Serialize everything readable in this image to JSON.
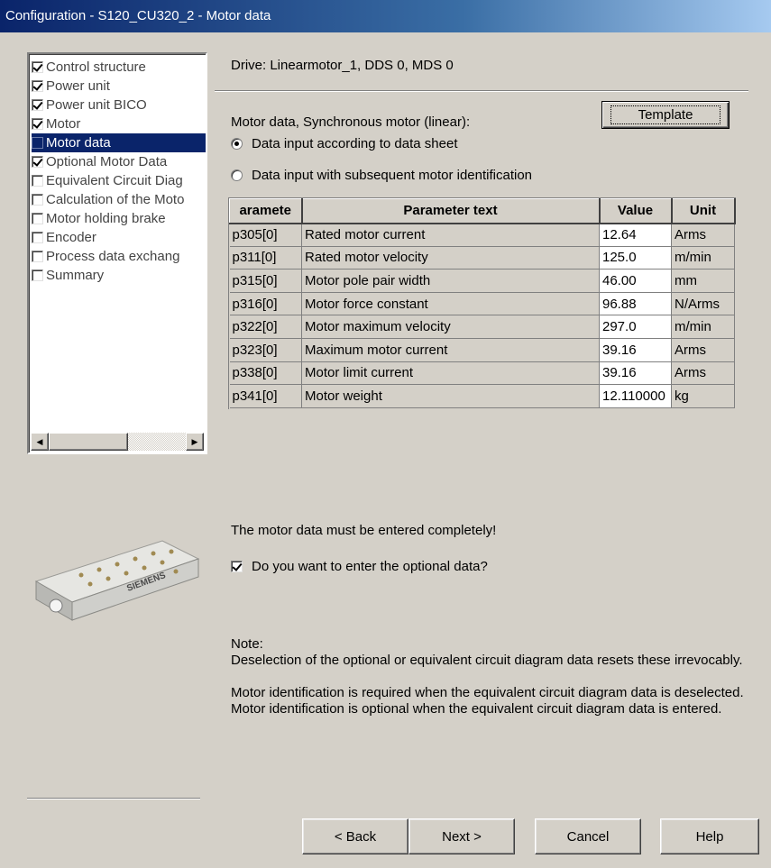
{
  "window": {
    "title": "Configuration - S120_CU320_2 - Motor data"
  },
  "tree": {
    "items": [
      {
        "label": "Control structure",
        "checked": true
      },
      {
        "label": "Power unit",
        "checked": true
      },
      {
        "label": "Power unit BICO",
        "checked": true
      },
      {
        "label": "Motor",
        "checked": true
      },
      {
        "label": "Motor data",
        "checked": false,
        "selected": true
      },
      {
        "label": "Optional Motor Data",
        "checked": true
      },
      {
        "label": "Equivalent Circuit Diag",
        "checked": false
      },
      {
        "label": "Calculation of the Moto",
        "checked": false
      },
      {
        "label": "Motor holding brake",
        "checked": false
      },
      {
        "label": "Encoder",
        "checked": false
      },
      {
        "label": "Process data exchang",
        "checked": false
      },
      {
        "label": "Summary",
        "checked": false
      }
    ]
  },
  "main": {
    "drive_label": "Drive: Linearmotor_1, DDS 0, MDS 0",
    "section_label": "Motor data, Synchronous motor (linear):",
    "template_button": "Template",
    "radio_datasheet": "Data input according to data sheet",
    "radio_identification": "Data input with subsequent motor identification",
    "table": {
      "headers": [
        "aramete",
        "Parameter text",
        "Value",
        "Unit"
      ],
      "rows": [
        [
          "p305[0]",
          "Rated motor current",
          "12.64",
          "Arms"
        ],
        [
          "p311[0]",
          "Rated motor velocity",
          "125.0",
          "m/min"
        ],
        [
          "p315[0]",
          "Motor pole pair width",
          "46.00",
          "mm"
        ],
        [
          "p316[0]",
          "Motor force constant",
          "96.88",
          "N/Arms"
        ],
        [
          "p322[0]",
          "Motor maximum velocity",
          "297.0",
          "m/min"
        ],
        [
          "p323[0]",
          "Maximum motor current",
          "39.16",
          "Arms"
        ],
        [
          "p338[0]",
          "Motor limit current",
          "39.16",
          "Arms"
        ],
        [
          "p341[0]",
          "Motor weight",
          "12.110000",
          "kg"
        ]
      ]
    },
    "must_text": "The motor data must be entered completely!",
    "optional_question": "Do you want to enter the optional data?",
    "note_title": "Note:",
    "note_1": "Deselection of the optional or equivalent circuit diagram data resets these irrevocably.",
    "note_2": "Motor identification is required when the equivalent circuit diagram data is deselected. Motor identification is optional when the equivalent circuit diagram data is entered.",
    "motor_brand": "SIEMENS"
  },
  "footer": {
    "back": "< Back",
    "next": "Next >",
    "cancel": "Cancel",
    "help": "Help"
  }
}
